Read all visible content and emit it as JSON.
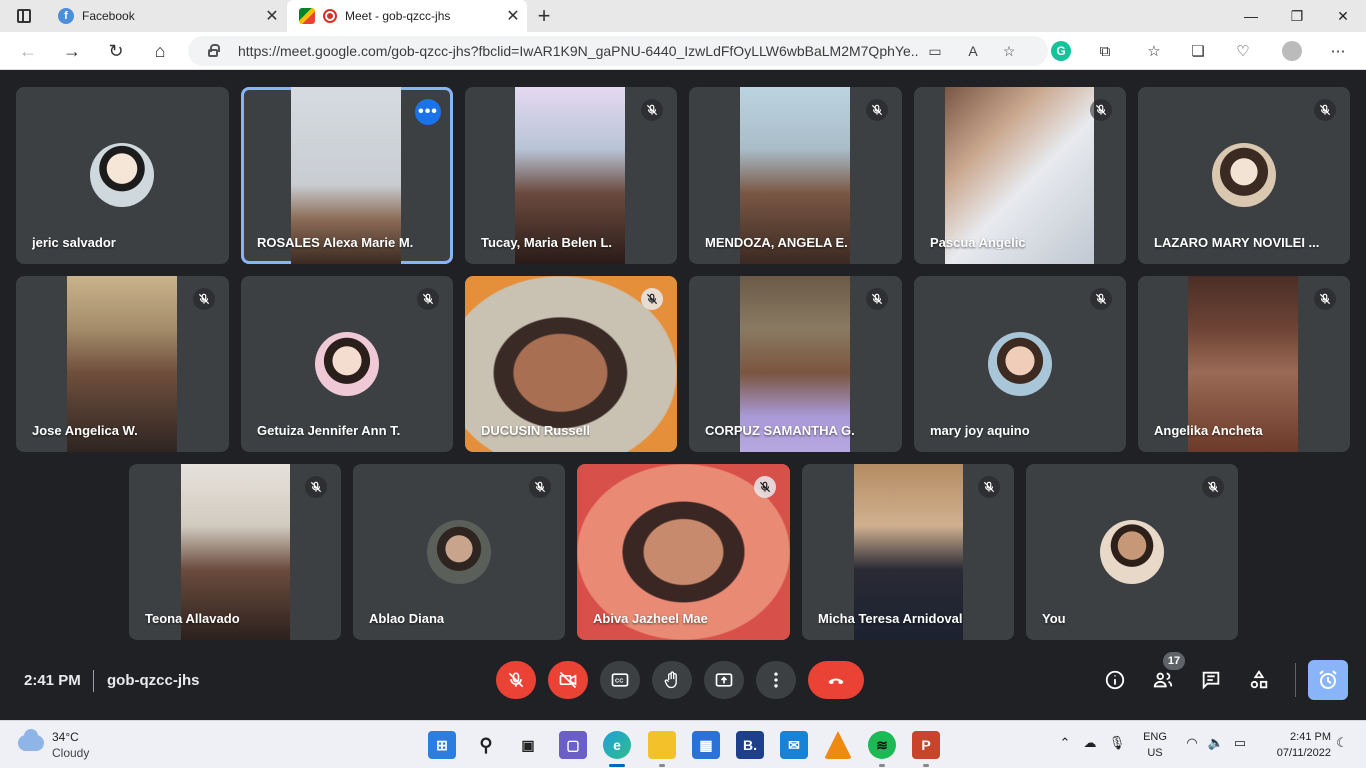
{
  "browser": {
    "tabs": [
      {
        "label": "Facebook",
        "icon": "facebook-icon",
        "active": false
      },
      {
        "label": "Meet - gob-qzcc-jhs",
        "icon": "google-meet-icon",
        "active": true,
        "recording_indicator": "red-record-dot"
      }
    ],
    "url": "https://meet.google.com/gob-qzcc-jhs?fbclid=IwAR1K9N_gaPNU-6440_IzwLdFfOyLLW6wbBaLM2M7QphYe...",
    "extension_icons": [
      "video-camera-icon",
      "read-aloud-icon",
      "add-favorite-icon",
      "grammarly-icon",
      "extensions-icon",
      "favorites-icon",
      "collections-icon",
      "browser-essentials-icon",
      "profile-avatar",
      "more-menu-icon"
    ]
  },
  "meet": {
    "participants": [
      {
        "name": "jeric salvador",
        "mode": "avatar",
        "muted": false,
        "row": 1
      },
      {
        "name": "ROSALES Alexa Marie M.",
        "mode": "video",
        "muted": false,
        "speaking": true,
        "row": 1
      },
      {
        "name": "Tucay, Maria Belen L.",
        "mode": "video",
        "muted": true,
        "row": 1
      },
      {
        "name": "MENDOZA, ANGELA E.",
        "mode": "video",
        "muted": true,
        "row": 1
      },
      {
        "name": "Pascua Angelic",
        "mode": "video",
        "muted": true,
        "row": 1
      },
      {
        "name": "LAZARO MARY NOVILEI ...",
        "mode": "avatar",
        "muted": true,
        "row": 1
      },
      {
        "name": "Jose Angelica W.",
        "mode": "video",
        "muted": true,
        "row": 2
      },
      {
        "name": "Getuiza Jennifer Ann T.",
        "mode": "avatar",
        "muted": true,
        "row": 2
      },
      {
        "name": "DUCUSIN Russell",
        "mode": "video",
        "muted": true,
        "row": 2
      },
      {
        "name": "CORPUZ SAMANTHA G.",
        "mode": "video",
        "muted": true,
        "row": 2
      },
      {
        "name": "mary joy aquino",
        "mode": "avatar",
        "muted": true,
        "row": 2
      },
      {
        "name": "Angelika Ancheta",
        "mode": "video",
        "muted": true,
        "row": 2
      },
      {
        "name": "Teona Allavado",
        "mode": "video",
        "muted": true,
        "row": 3
      },
      {
        "name": "Ablao Diana",
        "mode": "avatar",
        "muted": true,
        "row": 3
      },
      {
        "name": "Abiva Jazheel Mae",
        "mode": "video",
        "muted": true,
        "row": 3
      },
      {
        "name": "Micha Teresa Arnidoval",
        "mode": "video",
        "muted": true,
        "row": 3
      },
      {
        "name": "You",
        "mode": "avatar",
        "muted": true,
        "row": 3
      }
    ],
    "bottom_bar": {
      "time": "2:41 PM",
      "meeting_code": "gob-qzcc-jhs",
      "participant_count": "17",
      "controls": [
        "mic-off-button",
        "camera-off-button",
        "captions-button",
        "raise-hand-button",
        "present-button",
        "more-options-button",
        "leave-call-button"
      ],
      "right_controls": [
        "meeting-details-button",
        "people-button",
        "chat-button",
        "activities-button",
        "host-controls-button"
      ]
    },
    "colors": {
      "stage": "#202124",
      "tile": "#3c4043",
      "danger": "#ea4335",
      "accent": "#8ab4f8",
      "speaking_border": "#8ab4f8"
    }
  },
  "taskbar": {
    "weather": {
      "temp": "34°C",
      "condition": "Cloudy"
    },
    "apps": [
      "windows-start-icon",
      "search-icon",
      "task-view-icon",
      "teams-chat-icon",
      "edge-icon",
      "file-explorer-icon",
      "microsoft-store-icon",
      "b-app-icon",
      "mail-icon",
      "vlc-icon",
      "spotify-icon",
      "powerpoint-icon"
    ],
    "language": {
      "line1": "ENG",
      "line2": "US"
    },
    "clock": {
      "time": "2:41 PM",
      "date": "07/11/2022"
    }
  }
}
